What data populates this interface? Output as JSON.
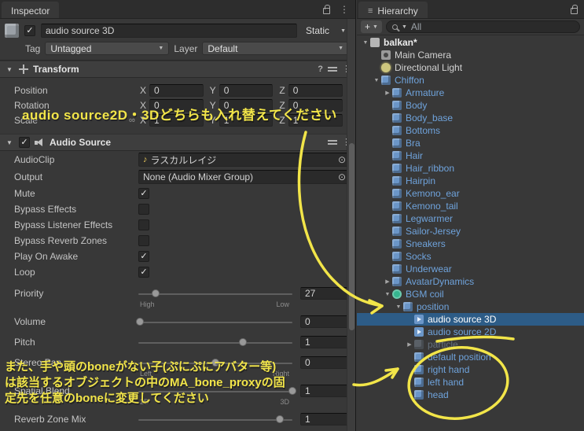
{
  "colors": {
    "selection": "#2d5c87",
    "prefab_blue": "#6fa3dc",
    "annotation_yellow": "#f2e549"
  },
  "icons": {
    "caret_down": "▼",
    "foldout_open": "▼",
    "foldout_closed": "▶",
    "check": "✓",
    "picker": "⊙",
    "music_note": "♪",
    "kebab": "⋮",
    "help": "?",
    "link": "∞",
    "plus": "+",
    "menu": "≡"
  },
  "inspector": {
    "tab": "Inspector",
    "gameobject": {
      "name": "audio source 3D",
      "active": true,
      "static_label": "Static",
      "tag_label": "Tag",
      "tag_value": "Untagged",
      "layer_label": "Layer",
      "layer_value": "Default"
    },
    "transform": {
      "title": "Transform",
      "axis_labels": [
        "X",
        "Y",
        "Z"
      ],
      "rows": [
        {
          "label": "Position",
          "x": "0",
          "y": "0",
          "z": "0",
          "link": false
        },
        {
          "label": "Rotation",
          "x": "0",
          "y": "0",
          "z": "0",
          "link": false
        },
        {
          "label": "Scale",
          "x": "1",
          "y": "1",
          "z": "1",
          "link": true
        }
      ]
    },
    "audio_source": {
      "title": "Audio Source",
      "enabled": true,
      "clip_label": "AudioClip",
      "clip_value": "ラスカルレイジ",
      "output_label": "Output",
      "output_value": "None (Audio Mixer Group)",
      "toggles": [
        {
          "label": "Mute",
          "checked": true
        },
        {
          "label": "Bypass Effects",
          "checked": false
        },
        {
          "label": "Bypass Listener Effects",
          "checked": false
        },
        {
          "label": "Bypass Reverb Zones",
          "checked": false
        },
        {
          "label": "Play On Awake",
          "checked": true
        },
        {
          "label": "Loop",
          "checked": true
        }
      ],
      "sliders": [
        {
          "label": "Priority",
          "value": "27",
          "pos": 0.11,
          "sub_left": "High",
          "sub_right": "Low"
        },
        {
          "label": "Volume",
          "value": "0",
          "pos": 0.01,
          "sub_left": "",
          "sub_right": ""
        },
        {
          "label": "Pitch",
          "value": "1",
          "pos": 0.68,
          "sub_left": "",
          "sub_right": ""
        },
        {
          "label": "Stereo Pan",
          "value": "0",
          "pos": 0.5,
          "sub_left": "Left",
          "sub_right": "Right"
        },
        {
          "label": "Spatial Blend",
          "value": "1",
          "pos": 1.0,
          "sub_left": "2D",
          "sub_right": "3D"
        },
        {
          "label": "Reverb Zone Mix",
          "value": "1",
          "pos": 0.92,
          "sub_left": "",
          "sub_right": ""
        }
      ]
    }
  },
  "hierarchy": {
    "tab": "Hierarchy",
    "search_text": "All",
    "items": [
      {
        "label": "balkan*",
        "depth": 0,
        "icon": "scene",
        "arrow": "open",
        "color": "normal",
        "bold": true,
        "selected": false
      },
      {
        "label": "Main Camera",
        "depth": 1,
        "icon": "camera",
        "arrow": null,
        "color": "normal",
        "bold": false,
        "selected": false
      },
      {
        "label": "Directional Light",
        "depth": 1,
        "icon": "light",
        "arrow": null,
        "color": "normal",
        "bold": false,
        "selected": false
      },
      {
        "label": "Chiffon",
        "depth": 1,
        "icon": "cube-blue",
        "arrow": "open",
        "color": "blue",
        "bold": false,
        "selected": false
      },
      {
        "label": "Armature",
        "depth": 2,
        "icon": "cube-blue",
        "arrow": "closed",
        "color": "blue",
        "bold": false,
        "selected": false
      },
      {
        "label": "Body",
        "depth": 2,
        "icon": "cube-blue",
        "arrow": null,
        "color": "blue",
        "bold": false,
        "selected": false
      },
      {
        "label": "Body_base",
        "depth": 2,
        "icon": "cube-blue",
        "arrow": null,
        "color": "blue",
        "bold": false,
        "selected": false
      },
      {
        "label": "Bottoms",
        "depth": 2,
        "icon": "cube-blue",
        "arrow": null,
        "color": "blue",
        "bold": false,
        "selected": false
      },
      {
        "label": "Bra",
        "depth": 2,
        "icon": "cube-blue",
        "arrow": null,
        "color": "blue",
        "bold": false,
        "selected": false
      },
      {
        "label": "Hair",
        "depth": 2,
        "icon": "cube-blue",
        "arrow": null,
        "color": "blue",
        "bold": false,
        "selected": false
      },
      {
        "label": "Hair_ribbon",
        "depth": 2,
        "icon": "cube-blue",
        "arrow": null,
        "color": "blue",
        "bold": false,
        "selected": false
      },
      {
        "label": "Hairpin",
        "depth": 2,
        "icon": "cube-blue",
        "arrow": null,
        "color": "blue",
        "bold": false,
        "selected": false
      },
      {
        "label": "Kemono_ear",
        "depth": 2,
        "icon": "cube-blue",
        "arrow": null,
        "color": "blue",
        "bold": false,
        "selected": false
      },
      {
        "label": "Kemono_tail",
        "depth": 2,
        "icon": "cube-blue",
        "arrow": null,
        "color": "blue",
        "bold": false,
        "selected": false
      },
      {
        "label": "Legwarmer",
        "depth": 2,
        "icon": "cube-blue",
        "arrow": null,
        "color": "blue",
        "bold": false,
        "selected": false
      },
      {
        "label": "Sailor-Jersey",
        "depth": 2,
        "icon": "cube-blue",
        "arrow": null,
        "color": "blue",
        "bold": false,
        "selected": false
      },
      {
        "label": "Sneakers",
        "depth": 2,
        "icon": "cube-blue",
        "arrow": null,
        "color": "blue",
        "bold": false,
        "selected": false
      },
      {
        "label": "Socks",
        "depth": 2,
        "icon": "cube-blue",
        "arrow": null,
        "color": "blue",
        "bold": false,
        "selected": false
      },
      {
        "label": "Underwear",
        "depth": 2,
        "icon": "cube-blue",
        "arrow": null,
        "color": "blue",
        "bold": false,
        "selected": false
      },
      {
        "label": "AvatarDynamics",
        "depth": 2,
        "icon": "cube-blue",
        "arrow": "closed",
        "color": "blue",
        "bold": false,
        "selected": false
      },
      {
        "label": "BGM coil",
        "depth": 2,
        "icon": "coil",
        "arrow": "open",
        "color": "blue",
        "bold": false,
        "selected": false
      },
      {
        "label": "position",
        "depth": 3,
        "icon": "cube-blue",
        "arrow": "open",
        "color": "blue",
        "bold": false,
        "selected": false
      },
      {
        "label": "audio source 3D",
        "depth": 4,
        "icon": "audio",
        "arrow": null,
        "color": "blue",
        "bold": false,
        "selected": true
      },
      {
        "label": "audio source 2D",
        "depth": 4,
        "icon": "audio",
        "arrow": null,
        "color": "blue",
        "bold": false,
        "selected": false
      },
      {
        "label": "particle",
        "depth": 4,
        "icon": "cube-dim",
        "arrow": "closed",
        "color": "dim",
        "bold": false,
        "selected": false
      },
      {
        "label": "default position",
        "depth": 4,
        "icon": "cube-blue",
        "arrow": null,
        "color": "blue",
        "bold": false,
        "selected": false
      },
      {
        "label": "right hand",
        "depth": 4,
        "icon": "cube-blue",
        "arrow": null,
        "color": "blue",
        "bold": false,
        "selected": false
      },
      {
        "label": "left hand",
        "depth": 4,
        "icon": "cube-blue",
        "arrow": null,
        "color": "blue",
        "bold": false,
        "selected": false
      },
      {
        "label": "head",
        "depth": 4,
        "icon": "cube-blue",
        "arrow": null,
        "color": "blue",
        "bold": false,
        "selected": false
      }
    ]
  },
  "annotations": {
    "top_text": "audio source2D・3Dどちらも入れ替えてください",
    "bottom_lines": [
      "また、手や頭のboneがない子(ぷにぷにアバター等)",
      "は該当するオブジェクトの中のMA_bone_proxyの固",
      "定先を任意のboneに変更してください"
    ]
  }
}
